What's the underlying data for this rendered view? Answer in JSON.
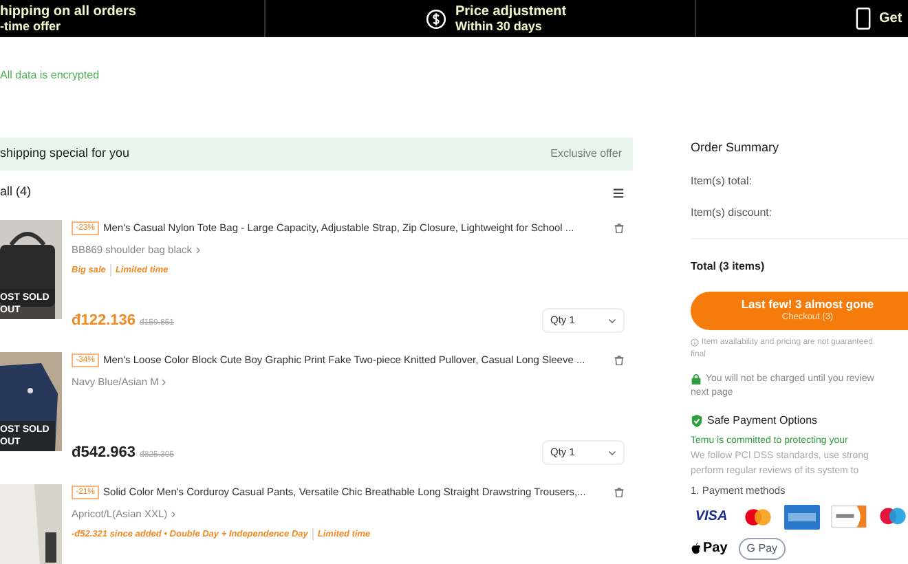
{
  "top_bar": [
    {
      "kind": "text",
      "title": "hipping on all orders",
      "subtitle": "-time offer"
    },
    {
      "kind": "dollar",
      "title": "Price adjustment",
      "subtitle": "Within 30 days"
    },
    {
      "kind": "phone",
      "title": "Get"
    }
  ],
  "security_note": "All data is encrypted",
  "banner": {
    "text": "shipping special for you",
    "tag": "Exclusive offer"
  },
  "cart_header": "all (4)",
  "items": [
    {
      "discount": "-23%",
      "title": "Men's Casual Nylon Tote Bag - Large Capacity, Adjustable Strap, Zip Closure, Lightweight for School ...",
      "variant": "BB869 shoulder bag black",
      "tags": [
        "Big sale",
        "Limited time"
      ],
      "price": "đ122.136",
      "old_price": "đ159.851",
      "qty": "Qty 1",
      "badge": [
        "OST SOLD",
        "OUT"
      ]
    },
    {
      "discount": "-34%",
      "title": "Men's Loose Color Block Cute Boy Graphic Print Fake Two-piece Knitted Pullover, Casual Long Sleeve ...",
      "variant": "Navy Blue/Asian M",
      "price": "đ542.963",
      "old_price": "đ825.305",
      "qty": "Qty 1",
      "badge": [
        "OST SOLD",
        "OUT"
      ]
    },
    {
      "discount": "-21%",
      "title": "Solid Color Men's Corduroy Casual Pants, Versatile Chic Breathable Long Straight Drawstring Trousers,...",
      "variant": "Apricot/L(Asian XXL)",
      "tags": [
        "-đ52.321 since added • Double Day + Independence Day",
        "Limited time"
      ]
    }
  ],
  "summary": {
    "title": "Order Summary",
    "rows": [
      "Item(s) total:",
      "Item(s) discount:"
    ],
    "total": "Total (3 items)",
    "checkout": {
      "headline": "Last few! 3 almost gone",
      "label": "Checkout (3)"
    },
    "notice": [
      "Item availability and pricing are not guaranteed",
      "final"
    ],
    "charge_note": [
      "You will not be charged until you review",
      "next page"
    ],
    "safe_title": "Safe Payment Options",
    "safe_lines": [
      {
        "kind": "green",
        "text": "Temu is committed to protecting your"
      },
      {
        "kind": "plain",
        "text": "We follow PCI DSS standards, use strong"
      },
      {
        "kind": "plain",
        "text": "perform regular reviews of its system to"
      }
    ],
    "methods_title": "1. Payment methods",
    "payment_methods": [
      {
        "kind": "visa",
        "label": "VISA"
      },
      {
        "kind": "mastercard"
      },
      {
        "kind": "amex"
      },
      {
        "kind": "discover"
      },
      {
        "kind": "maestro"
      },
      {
        "kind": "applepay",
        "label": "Pay"
      },
      {
        "kind": "gpay",
        "label": "G Pay"
      }
    ]
  }
}
